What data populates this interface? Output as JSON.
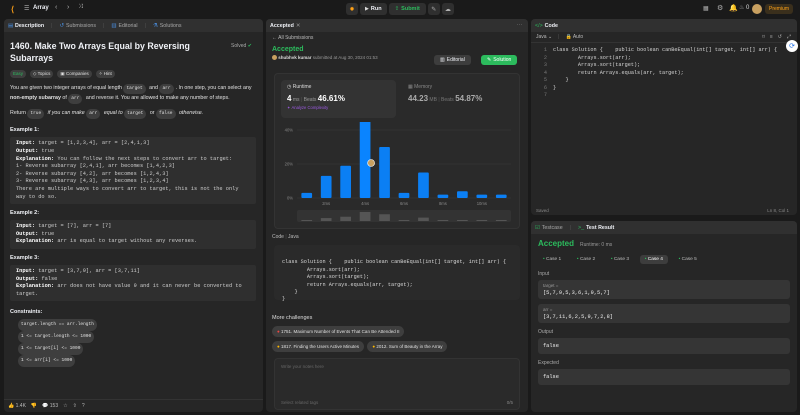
{
  "topbar": {
    "problem_list_label": "Array",
    "run_label": "Run",
    "submit_label": "Submit",
    "streak_count": "0",
    "premium_label": "Premium"
  },
  "left": {
    "tabs": [
      "Description",
      "Submissions",
      "Editorial",
      "Solutions"
    ],
    "title": "1460. Make Two Arrays Equal by Reversing Subarrays",
    "solved_label": "Solved",
    "difficulty": "Easy",
    "tags": [
      "Topics",
      "Companies",
      "Hint"
    ],
    "desc_p1_pre": "You are given two integer arrays of equal length ",
    "desc_c1": "target",
    "desc_p1_mid": " and ",
    "desc_c2": "arr",
    "desc_p1_mid2": ". In one step, you can select any ",
    "desc_p1_bold": "non-empty subarray",
    "desc_p1_mid3": " of ",
    "desc_c3": "arr",
    "desc_p1_end": " and reverse it. You are allowed to make any number of steps.",
    "desc_p2_pre": "Return ",
    "desc_c4": "true",
    "desc_p2_mid": " if you can make ",
    "desc_c5": "arr",
    "desc_p2_mid2": " equal to ",
    "desc_c6": "target",
    "desc_p2_mid3": " or ",
    "desc_c7": "false",
    "desc_p2_end": " otherwise.",
    "examples": [
      {
        "title": "Example 1:",
        "input_label": "Input:",
        "input": " target = [1,2,3,4], arr = [2,4,1,3]",
        "output_label": "Output:",
        "output": " true",
        "expl_label": "Explanation:",
        "explanation": " You can follow the next steps to convert arr to target:\n1- Reverse subarray [2,4,1], arr becomes [1,4,2,3]\n2- Reverse subarray [4,2], arr becomes [1,2,4,3]\n3- Reverse subarray [4,3], arr becomes [1,2,3,4]\nThere are multiple ways to convert arr to target, this is not the only way to do so."
      },
      {
        "title": "Example 2:",
        "input_label": "Input:",
        "input": " target = [7], arr = [7]",
        "output_label": "Output:",
        "output": " true",
        "expl_label": "Explanation:",
        "explanation": " arr is equal to target without any reverses."
      },
      {
        "title": "Example 3:",
        "input_label": "Input:",
        "input": " target = [3,7,9], arr = [3,7,11]",
        "output_label": "Output:",
        "output": " false",
        "expl_label": "Explanation:",
        "explanation": " arr does not have value 9 and it can never be converted to target."
      }
    ],
    "constraints_title": "Constraints:",
    "constraints": [
      "target.length == arr.length",
      "1 <= target.length <= 1000",
      "1 <= target[i] <= 1000",
      "1 <= arr[i] <= 1000"
    ],
    "likes": "1.4K",
    "comments": "153"
  },
  "middle": {
    "tab_label": "Accepted",
    "back_label": "All Submissions",
    "status": "Accepted",
    "author": "shubhvk kumar",
    "submitted": "submitted at Aug 30, 2024 01:53",
    "editorial_label": "Editorial",
    "solution_label": "Solution",
    "runtime_label": "Runtime",
    "runtime_value": "4",
    "runtime_unit": "ms",
    "beats_label": "Beats",
    "runtime_beats": "46.61%",
    "analyze_label": "Analyze Complexity",
    "memory_label": "Memory",
    "memory_value": "44.23",
    "memory_unit": "MB",
    "memory_beats": "54.87%",
    "chart_y_ticks": [
      "40%",
      "20%",
      "0%"
    ],
    "chart_x_ticks": [
      "2ms",
      "4ms",
      "6ms",
      "8ms",
      "10ms"
    ],
    "code_tab": "Code",
    "code_lang": "Java",
    "code_lines": [
      "class Solution {    public boolean canBeEqual(int[] target, int[] arr) {",
      "        Arrays.sort(arr);",
      "        Arrays.sort(target);",
      "        return Arrays.equals(arr, target);",
      "    }",
      "}"
    ],
    "more_title": "More challenges",
    "challenges": [
      "1751. Maximum Number of Events That Can Be Attended II",
      "1817. Finding the Users Active Minutes",
      "2012. Sum of Beauty in the Array"
    ],
    "notes_placeholder": "Write your notes here",
    "related_placeholder": "Select related tags",
    "notes_count": "0/5"
  },
  "chart_data": {
    "type": "bar",
    "categories": [
      "1ms",
      "2ms",
      "3ms",
      "4ms",
      "5ms",
      "6ms",
      "7ms",
      "8ms",
      "9ms",
      "10ms",
      "11ms"
    ],
    "values": [
      3,
      13,
      19,
      46,
      30,
      3,
      15,
      2,
      4,
      2,
      2
    ],
    "highlight_index": 3,
    "ylim": [
      0,
      40
    ]
  },
  "right": {
    "code_title": "Code",
    "lang": "Java",
    "auto_label": "Auto",
    "line_numbers": [
      "1",
      "2",
      "3",
      "4",
      "5",
      "6",
      "7"
    ],
    "saved_label": "Saved",
    "cursor_pos": "Ln 8, Col 1",
    "testcase_tab": "Testcase",
    "result_tab": "Test Result",
    "result_status": "Accepted",
    "result_runtime": "Runtime: 0 ms",
    "cases": [
      "Case 1",
      "Case 2",
      "Case 3",
      "Case 4",
      "Case 5"
    ],
    "input_label": "Input",
    "target_label": "target =",
    "target_value": "[5,7,9,5,3,6,1,9,5,7]",
    "arr_label": "arr =",
    "arr_value": "[3,7,11,6,2,5,9,7,2,8]",
    "output_label": "Output",
    "output_value": "false",
    "expected_label": "Expected",
    "expected_value": "false"
  },
  "colors": {
    "accent_green": "#2cbb5d",
    "bar_blue": "#0a84ff",
    "premium": "#ffa116"
  }
}
